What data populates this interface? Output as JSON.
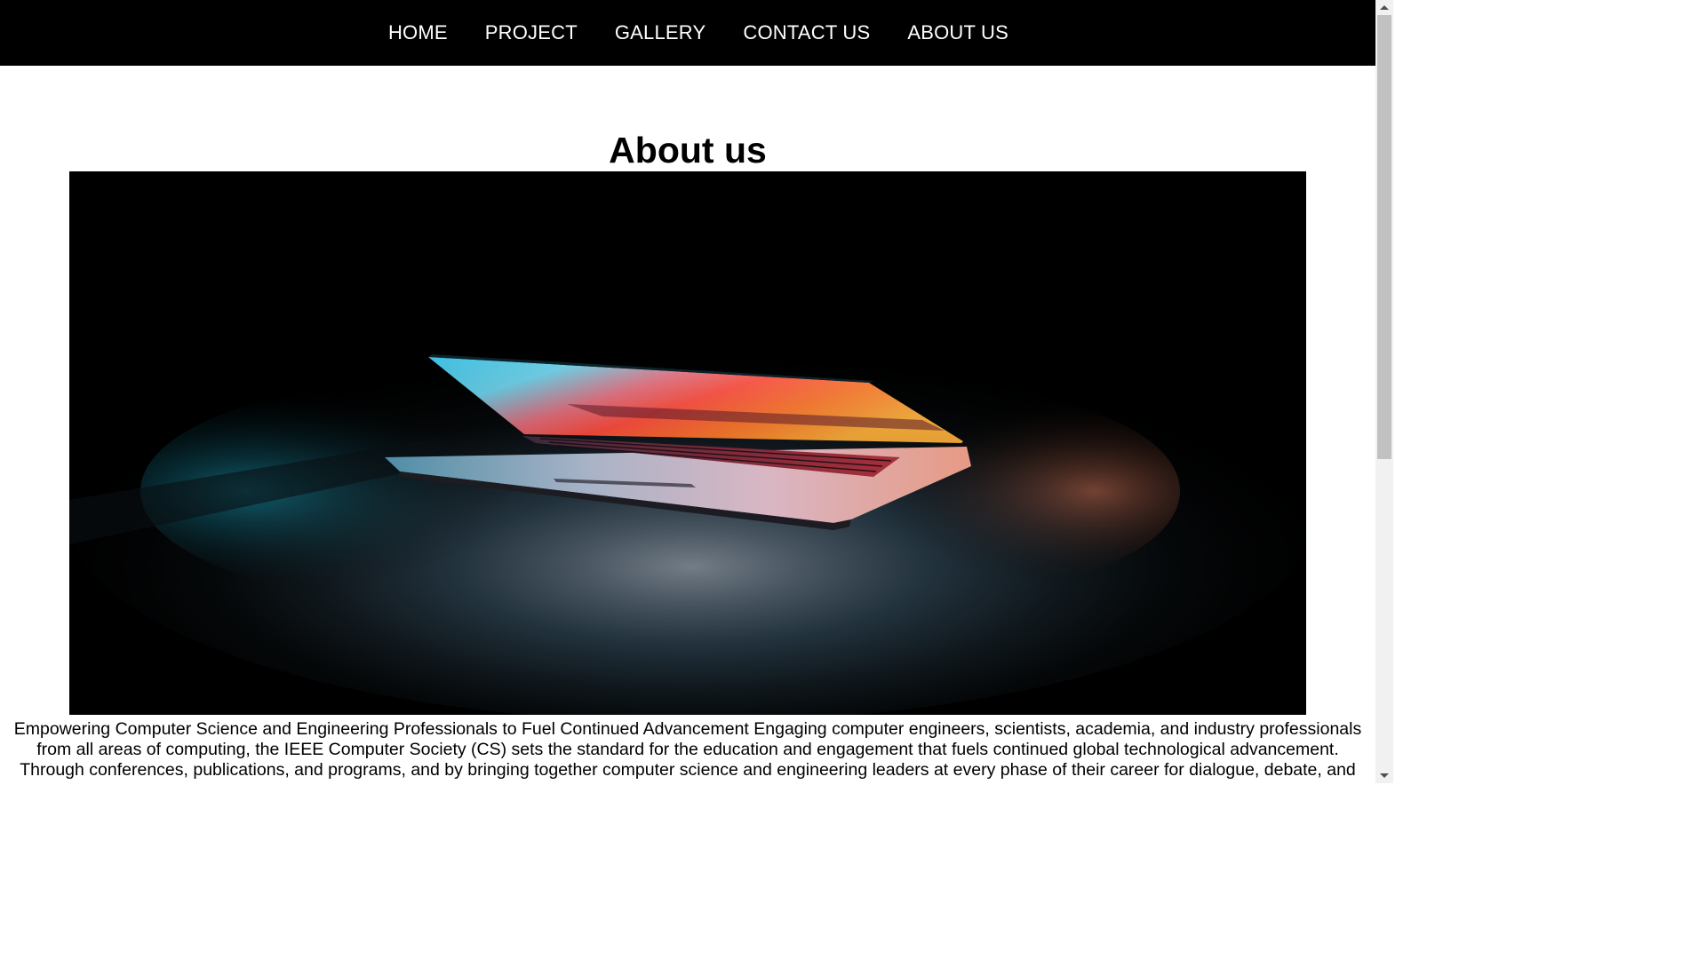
{
  "nav": {
    "items": [
      {
        "label": "HOME"
      },
      {
        "label": "PROJECT"
      },
      {
        "label": "GALLERY"
      },
      {
        "label": "CONTACT US"
      },
      {
        "label": "ABOUT US"
      }
    ]
  },
  "main": {
    "title": "About us",
    "body": "Empowering Computer Science and Engineering Professionals to Fuel Continued Advancement Engaging computer engineers, scientists, academia, and industry professionals from all areas of computing, the IEEE Computer Society (CS) sets the standard for the education and engagement that fuels continued global technological advancement. Through conferences, publications, and programs, and by bringing together computer science and engineering leaders at every phase of their career for dialogue, debate, and"
  },
  "colors": {
    "navbar_bg": "#000000",
    "nav_text": "#ffffff",
    "page_bg": "#ffffff",
    "text": "#000000"
  },
  "icons": {
    "scroll_up": "triangle-up-icon",
    "scroll_down": "triangle-down-icon"
  }
}
